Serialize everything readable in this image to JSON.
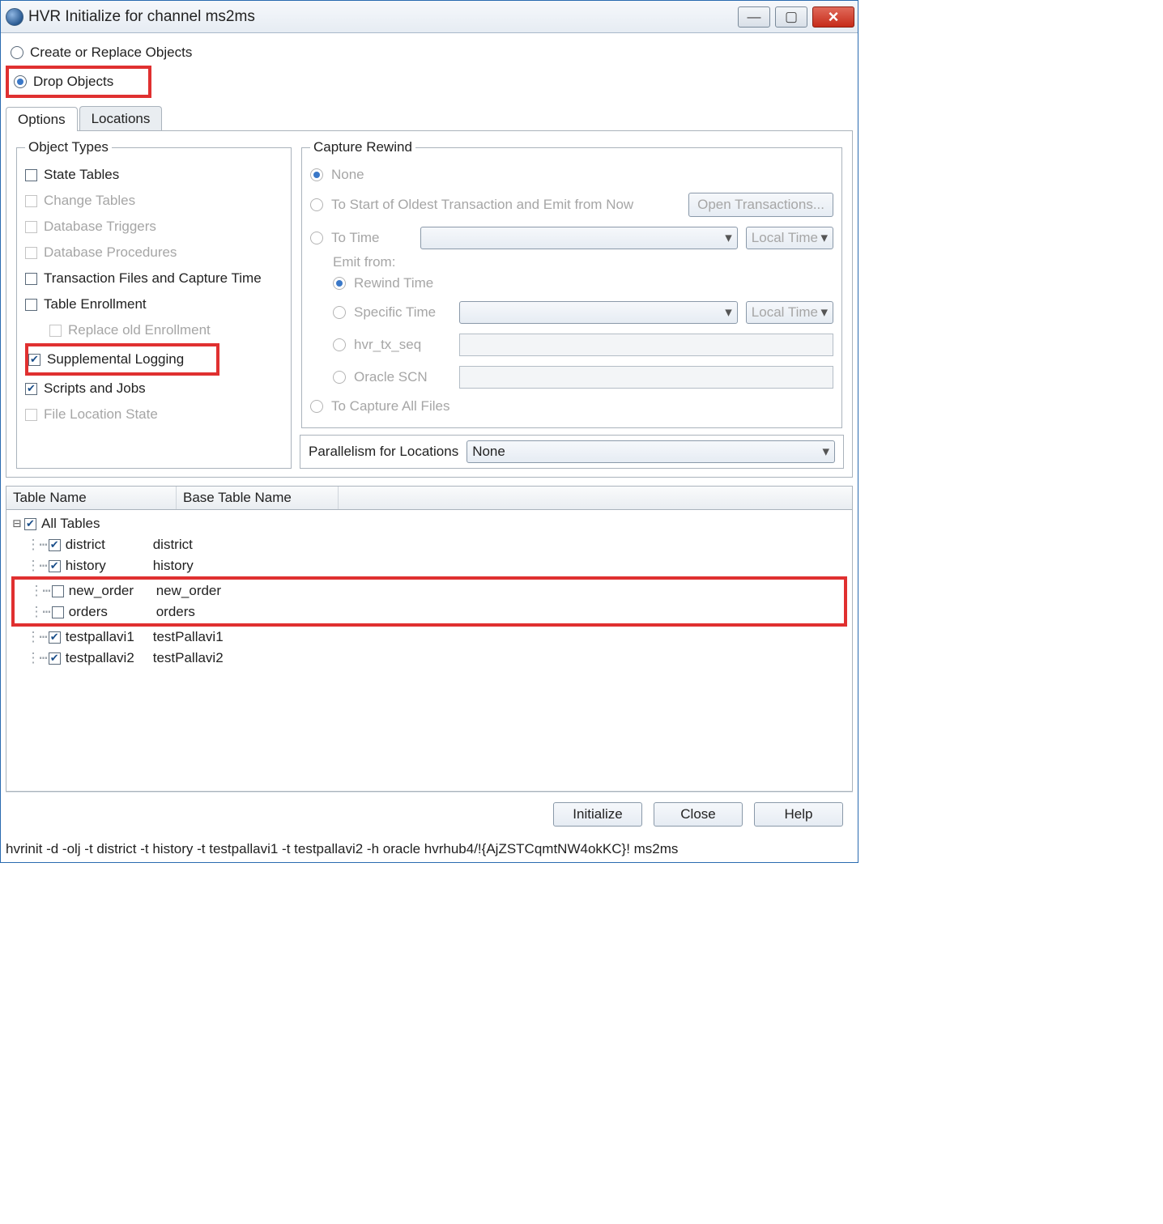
{
  "window": {
    "title": "HVR Initialize for channel ms2ms"
  },
  "radios": {
    "create": "Create or Replace Objects",
    "drop": "Drop Objects",
    "selected": "drop"
  },
  "tabs": {
    "options": "Options",
    "locations": "Locations",
    "active": "options"
  },
  "object_types": {
    "legend": "Object Types",
    "state_tables": "State Tables",
    "change_tables": "Change Tables",
    "database_triggers": "Database Triggers",
    "database_procedures": "Database Procedures",
    "txn_files": "Transaction Files and Capture Time",
    "table_enrollment": "Table Enrollment",
    "replace_old_enrollment": "Replace old Enrollment",
    "supplemental_logging": "Supplemental Logging",
    "scripts_jobs": "Scripts and Jobs",
    "file_location_state": "File Location State"
  },
  "capture_rewind": {
    "legend": "Capture Rewind",
    "none": "None",
    "to_start": "To Start of Oldest Transaction and Emit from Now",
    "open_txn_btn": "Open Transactions...",
    "to_time": "To Time",
    "local_time": "Local Time",
    "emit_from": "Emit from:",
    "rewind_time": "Rewind Time",
    "specific_time": "Specific Time",
    "hvr_tx_seq": "hvr_tx_seq",
    "oracle_scn": "Oracle SCN",
    "to_capture_all": "To Capture All Files"
  },
  "parallelism": {
    "label": "Parallelism for Locations",
    "value": "None"
  },
  "table": {
    "col1": "Table Name",
    "col2": "Base Table Name",
    "root": "All Tables",
    "rows": [
      {
        "name": "district",
        "base": "district",
        "checked": true
      },
      {
        "name": "history",
        "base": "history",
        "checked": true
      },
      {
        "name": "new_order",
        "base": "new_order",
        "checked": false
      },
      {
        "name": "orders",
        "base": "orders",
        "checked": false
      },
      {
        "name": "testpallavi1",
        "base": "testPallavi1",
        "checked": true
      },
      {
        "name": "testpallavi2",
        "base": "testPallavi2",
        "checked": true
      }
    ]
  },
  "buttons": {
    "initialize": "Initialize",
    "close": "Close",
    "help": "Help"
  },
  "cmdline": "hvrinit -d -olj -t district -t history -t testpallavi1 -t testpallavi2 -h oracle hvrhub4/!{AjZSTCqmtNW4okKC}! ms2ms"
}
